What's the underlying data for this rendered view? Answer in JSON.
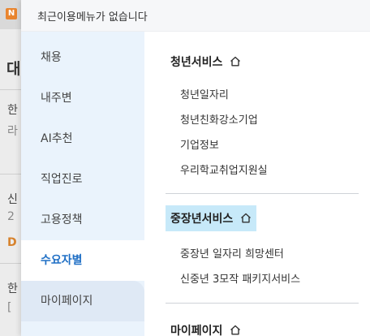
{
  "background": {
    "logo_letter": "N",
    "heading": "대",
    "cards": [
      {
        "line1": "한",
        "line2": "라"
      },
      {
        "line1": "신",
        "line2": "2"
      },
      {
        "line1": "D",
        "line2": ""
      },
      {
        "line1": "한",
        "line2": "["
      }
    ]
  },
  "menu": {
    "recent_message": "최근이용메뉴가 없습니다",
    "nav_items": [
      {
        "label": "채용"
      },
      {
        "label": "내주변"
      },
      {
        "label": "AI추천"
      },
      {
        "label": "직업진로"
      },
      {
        "label": "고용정책"
      },
      {
        "label": "수요자별",
        "active": true
      },
      {
        "label": "마이페이지"
      }
    ],
    "sections": [
      {
        "title": "청년서비스",
        "links": [
          "청년일자리",
          "청년친화강소기업",
          "기업정보",
          "우리학교취업지원실"
        ]
      },
      {
        "title": "중장년서비스",
        "highlighted": true,
        "links": [
          "중장년 일자리 희망센터",
          "신중년 3모작 패키지서비스"
        ]
      },
      {
        "title": "마이페이지",
        "links": []
      }
    ],
    "colors": {
      "nav_background": "#eaf3fc",
      "active_text": "#1f6fc5",
      "highlight": "#c7e9f9"
    },
    "icons": {
      "section_home": "home-icon",
      "logo": "site-logo-icon"
    }
  }
}
